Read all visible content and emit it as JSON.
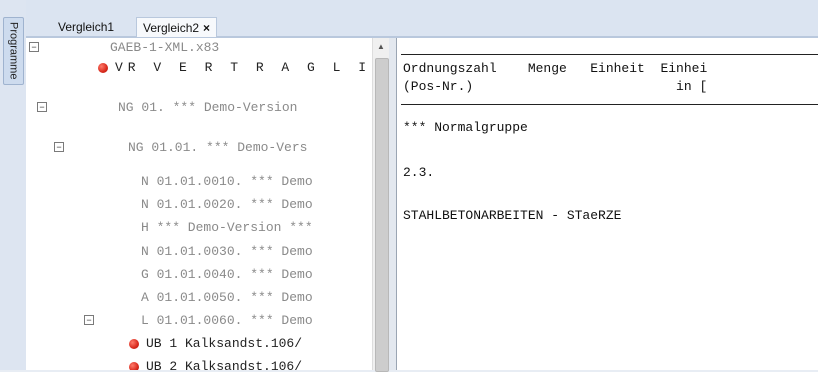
{
  "sidebar": {
    "tab_label": "Programme"
  },
  "tabs": [
    {
      "label": "Vergleich1"
    },
    {
      "label": "Vergleich2",
      "close": "×"
    }
  ],
  "tree": {
    "rows": [
      {
        "text": "GAEB-1-XML.x83",
        "toggle": "−"
      },
      {
        "text": "VR V E R T R A G L I C",
        "dot": "red"
      },
      {
        "text": "NG 01. *** Demo-Version",
        "toggle": "−"
      },
      {
        "text": "NG 01.01. *** Demo-Vers",
        "toggle": "−"
      },
      {
        "text": "N 01.01.0010. *** Demo"
      },
      {
        "text": "N 01.01.0020. *** Demo"
      },
      {
        "text": "H *** Demo-Version ***"
      },
      {
        "text": "N 01.01.0030. *** Demo"
      },
      {
        "text": "G 01.01.0040. *** Demo"
      },
      {
        "text": "A 01.01.0050. *** Demo"
      },
      {
        "text": "L 01.01.0060. *** Demo",
        "toggle": "−"
      },
      {
        "text": "UB  1 Kalksandst.106/",
        "dot": "red"
      },
      {
        "text": "UB  2 Kalksandst.106/",
        "dot": "red"
      }
    ]
  },
  "document": {
    "header_line1": "Ordnungszahl    Menge   Einheit  Einhei",
    "header_line2": "(Pos-Nr.)                          in [",
    "line1": "*** Normalgruppe",
    "line2": "2.3.",
    "line3": "STAHLBETONARBEITEN - STaeRZE"
  }
}
